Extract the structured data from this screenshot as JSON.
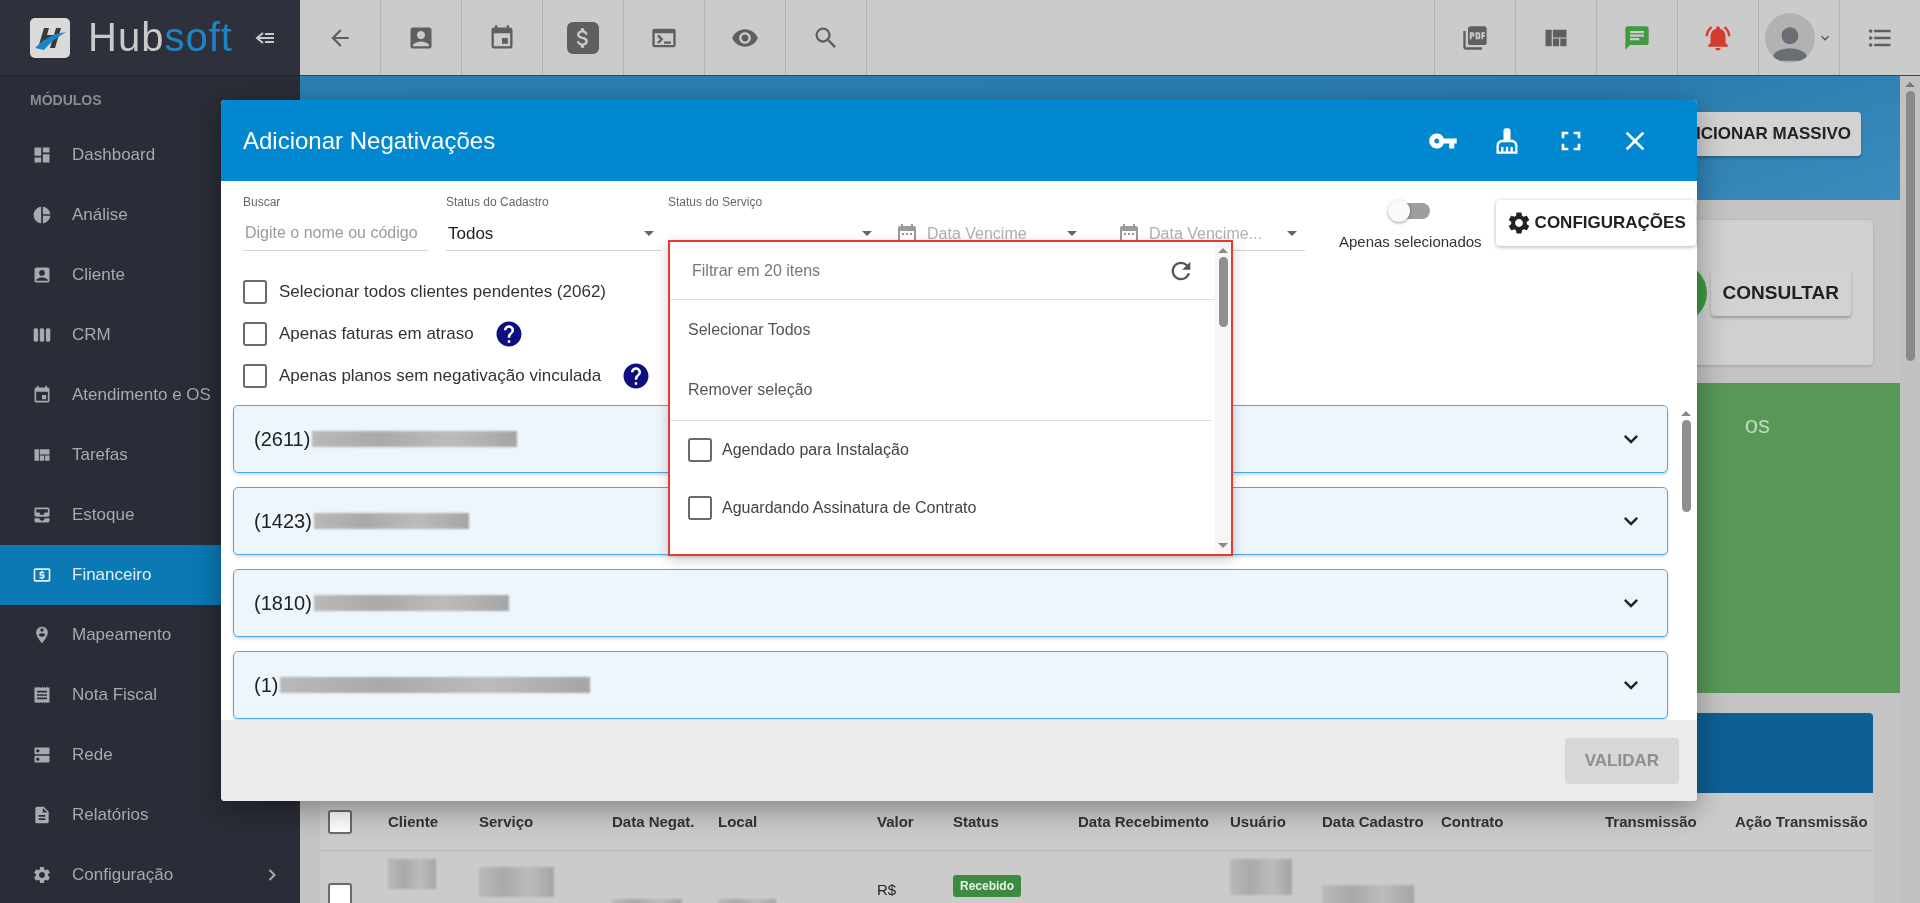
{
  "sidebar": {
    "logo": {
      "text": "Hub",
      "accent": "soft"
    },
    "section": "MÓDULOS",
    "items": [
      {
        "label": "Dashboard",
        "selected": false,
        "kind": "link"
      },
      {
        "label": "Análise",
        "selected": false,
        "kind": "link"
      },
      {
        "label": "Cliente",
        "selected": false,
        "kind": "link"
      },
      {
        "label": "CRM",
        "selected": false,
        "kind": "link"
      },
      {
        "label": "Atendimento e OS",
        "selected": false,
        "kind": "link"
      },
      {
        "label": "Tarefas",
        "selected": false,
        "kind": "link"
      },
      {
        "label": "Estoque",
        "selected": false,
        "kind": "link"
      },
      {
        "label": "Financeiro",
        "selected": true,
        "kind": "link"
      },
      {
        "label": "Mapeamento",
        "selected": false,
        "kind": "link"
      },
      {
        "label": "Nota Fiscal",
        "selected": false,
        "kind": "link"
      },
      {
        "label": "Rede",
        "selected": false,
        "kind": "link"
      },
      {
        "label": "Relatórios",
        "selected": false,
        "kind": "link"
      },
      {
        "label": "Configuração",
        "selected": false,
        "kind": "group"
      }
    ]
  },
  "background": {
    "bulk_button": "ICIONAR MASSIVO",
    "query_button": "CONSULTAR",
    "panel_title": "os",
    "table": {
      "select_all_checked": false,
      "columns": [
        "Cliente",
        "Serviço",
        "Data Negat.",
        "Local",
        "Valor",
        "Status",
        "Data Recebimento",
        "Usuário",
        "Data Cadastro",
        "Contrato",
        "Transmissão",
        "Ação Transmissão"
      ],
      "rows": [
        {
          "value": "R$",
          "status": "Recebido",
          "checked": false
        }
      ]
    }
  },
  "dialog": {
    "title": "Adicionar Negativações",
    "filters": [
      {
        "kind": "text",
        "label": "Buscar",
        "placeholder": "Digite o nome ou código"
      },
      {
        "kind": "select",
        "label": "Status do Cadastro",
        "value": "Todos"
      },
      {
        "kind": "select",
        "label": "Status do Serviço"
      },
      {
        "kind": "date",
        "placeholder": "Data Vencime"
      },
      {
        "kind": "date",
        "placeholder": "Data Vencime..."
      }
    ],
    "toggle": {
      "label": "Apenas selecionados",
      "on": false
    },
    "settings_button": "CONFIGURAÇÕES",
    "options": [
      {
        "label": "Selecionar todos clientes pendentes (2062)",
        "checked": false,
        "help": false
      },
      {
        "label": "Apenas faturas em atraso",
        "checked": false,
        "help": true
      },
      {
        "label": "Apenas planos sem negativação vinculada",
        "checked": false,
        "help": true
      }
    ],
    "clients": [
      {
        "code": "(2611)",
        "expanded": false
      },
      {
        "code": "(1423)",
        "expanded": false
      },
      {
        "code": "(1810)",
        "expanded": false
      },
      {
        "code": "(1)",
        "expanded": false
      }
    ],
    "validate_button": {
      "label": "VALIDAR",
      "disabled": true
    },
    "dropdown": {
      "placeholder": "Filtrar em 20 itens",
      "actions": [
        "Selecionar Todos",
        "Remover seleção"
      ],
      "items": [
        {
          "label": "Agendado para Instalação",
          "checked": false
        },
        {
          "label": "Aguardando Assinatura de Contrato",
          "checked": false
        }
      ]
    }
  }
}
